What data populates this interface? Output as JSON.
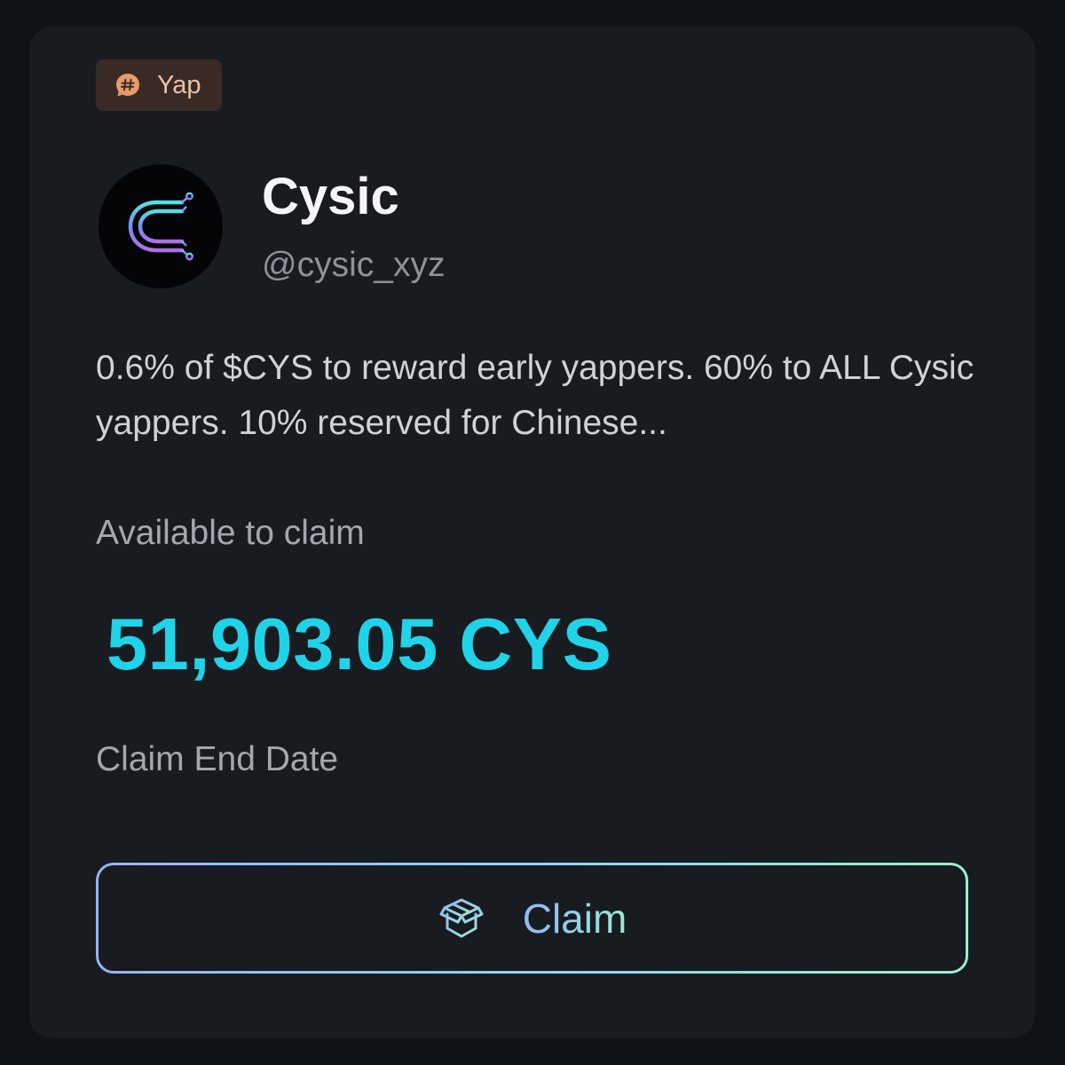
{
  "tag": {
    "icon": "hash-icon",
    "label": "Yap",
    "color": "#e79b6d"
  },
  "project": {
    "logo_icon": "cysic-c-logo",
    "name": "Cysic",
    "handle": "@cysic_xyz"
  },
  "description": "0.6% of $CYS to reward early yappers. 60% to ALL Cysic yappers. 10% reserved for Chinese...",
  "claim": {
    "available_label": "Available to claim",
    "amount": "51,903.05 CYS",
    "amount_color": "#1fd3e9",
    "end_date_label": "Claim End Date",
    "button_icon": "gift-box-icon",
    "button_label": "Claim"
  }
}
